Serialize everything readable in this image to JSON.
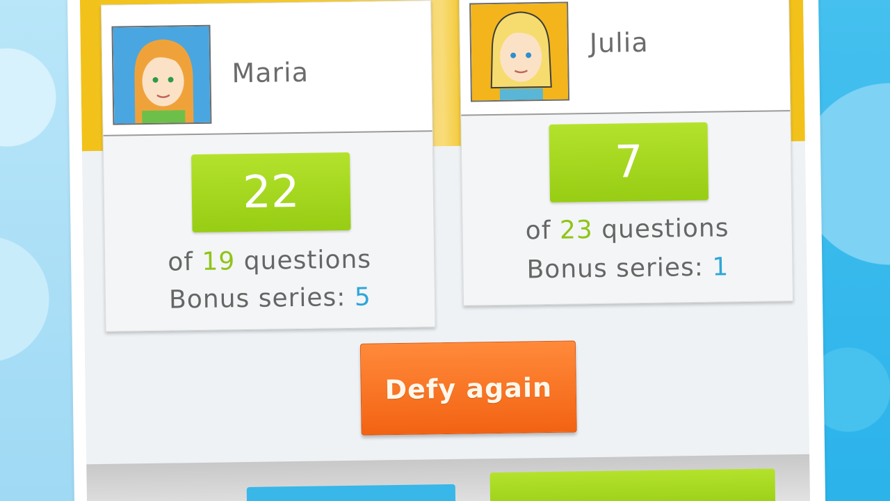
{
  "players": [
    {
      "name": "Maria",
      "score": "22",
      "questions_prefix": "of",
      "questions_count": "19",
      "questions_suffix": "questions",
      "bonus_label": "Bonus series:",
      "bonus_value": "5",
      "avatar_bg": "#4aa6e0",
      "avatar_hair": "#f0a23a"
    },
    {
      "name": "Julia",
      "score": "7",
      "questions_prefix": "of",
      "questions_count": "23",
      "questions_suffix": "questions",
      "bonus_label": "Bonus series:",
      "bonus_value": "1",
      "avatar_bg": "#f3b51b",
      "avatar_hair": "#f6dc6e"
    }
  ],
  "actions": {
    "defy_label": "Defy again"
  },
  "colors": {
    "accent_green": "#97cd14",
    "accent_orange": "#f26313",
    "accent_blue": "#2ea6d9",
    "band_yellow": "#f2c21a"
  }
}
